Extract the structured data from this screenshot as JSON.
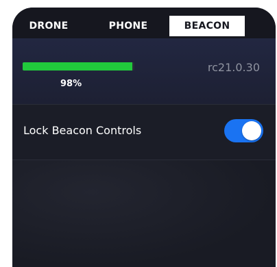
{
  "tabs": {
    "drone": "DRONE",
    "phone": "PHONE",
    "beacon": "BEACON",
    "active": "BEACON"
  },
  "battery": {
    "percent_label": "98%",
    "level": 0.98,
    "fill_color": "#21c93c"
  },
  "firmware": {
    "version": "rc21.0.30"
  },
  "settings": {
    "lock_label": "Lock Beacon Controls",
    "lock_enabled": true,
    "toggle_color": "#1a73f2"
  }
}
